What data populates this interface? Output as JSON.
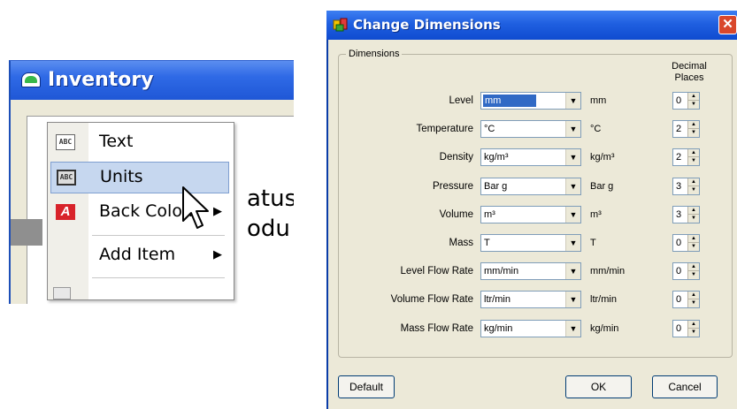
{
  "inventory": {
    "title": "Inventory",
    "background_text_1": "atus",
    "background_text_2": "odu",
    "context_menu": {
      "items": [
        {
          "label": "Text",
          "icon": "abc-text-icon",
          "highlighted": false,
          "has_submenu": false
        },
        {
          "label": "Units",
          "icon": "abc-units-icon",
          "highlighted": true,
          "has_submenu": false
        },
        {
          "label": "Back Colour",
          "icon": "color-a-icon",
          "highlighted": false,
          "has_submenu": true
        },
        {
          "label": "Add Item",
          "icon": "",
          "highlighted": false,
          "has_submenu": true
        }
      ],
      "submenu_arrow": "▶"
    }
  },
  "dialog": {
    "title": "Change Dimensions",
    "close_glyph": "✕",
    "group_label": "Dimensions",
    "decimal_header": "Decimal\nPlaces",
    "rows": [
      {
        "label": "Level",
        "value": "mm",
        "unit": "mm",
        "decimals": "0",
        "selected": true
      },
      {
        "label": "Temperature",
        "value": "°C",
        "unit": "°C",
        "decimals": "2",
        "selected": false
      },
      {
        "label": "Density",
        "value": "kg/m³",
        "unit": "kg/m³",
        "decimals": "2",
        "selected": false
      },
      {
        "label": "Pressure",
        "value": "Bar g",
        "unit": "Bar g",
        "decimals": "3",
        "selected": false
      },
      {
        "label": "Volume",
        "value": "m³",
        "unit": "m³",
        "decimals": "3",
        "selected": false
      },
      {
        "label": "Mass",
        "value": "T",
        "unit": "T",
        "decimals": "0",
        "selected": false
      },
      {
        "label": "Level Flow Rate",
        "value": "mm/min",
        "unit": "mm/min",
        "decimals": "0",
        "selected": false
      },
      {
        "label": "Volume Flow Rate",
        "value": "ltr/min",
        "unit": "ltr/min",
        "decimals": "0",
        "selected": false
      },
      {
        "label": "Mass Flow Rate",
        "value": "kg/min",
        "unit": "kg/min",
        "decimals": "0",
        "selected": false
      }
    ],
    "buttons": {
      "default": "Default",
      "ok": "OK",
      "cancel": "Cancel"
    },
    "colors": {
      "titlebar": "#1f5fe0",
      "face": "#ece9d8",
      "selection": "#316ac5",
      "close": "#d9472b"
    }
  }
}
